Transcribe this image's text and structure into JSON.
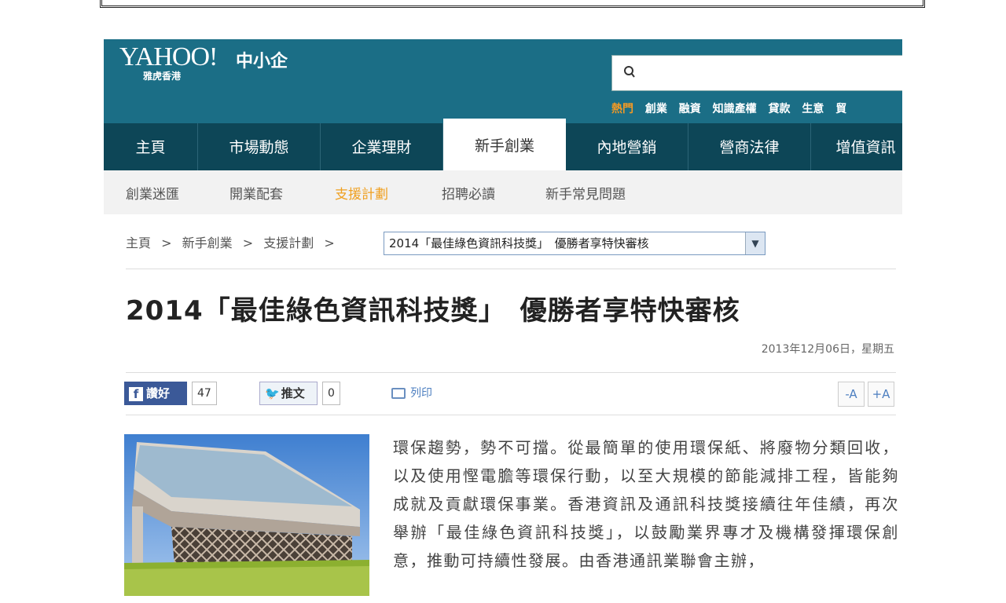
{
  "header": {
    "logo_text": "YAHOO!",
    "logo_sub": "雅虎香港",
    "section_name": "中小企",
    "search_placeholder": "",
    "topics": [
      "熱門",
      "創業",
      "融資",
      "知識產權",
      "貸款",
      "生意",
      "貿"
    ]
  },
  "nav": {
    "items": [
      {
        "label": "主頁"
      },
      {
        "label": "市場動態"
      },
      {
        "label": "企業理財"
      },
      {
        "label": "新手創業"
      },
      {
        "label": "內地營銷"
      },
      {
        "label": "營商法律"
      },
      {
        "label": "增值資訊"
      }
    ],
    "active_index": 3
  },
  "subnav": {
    "items": [
      "創業迷匯",
      "開業配套",
      "支援計劃",
      "招聘必讀",
      "新手常見問題"
    ],
    "active_index": 2
  },
  "breadcrumb": {
    "items": [
      "主頁",
      "新手創業",
      "支援計劃"
    ],
    "separator": ">",
    "selected": "2014「最佳綠色資訊科技獎」　優勝者享特快審核"
  },
  "article": {
    "title": "2014「最佳綠色資訊科技獎」　優勝者享特快審核",
    "date": "2013年12月06日，星期五",
    "body": "環保趨勢，勢不可擋。從最簡單的使用環保紙、將廢物分類回收，以及使用慳電膽等環保行動，以至大規模的節能減排工程，皆能夠成就及貢獻環保事業。香港資訊及通訊科技獎接續往年佳績，再次舉辦「最佳綠色資訊科技獎」，以鼓勵業界專才及機構發揮環保創意，推動可持續性發展。由香港通訊業聯會主辦，"
  },
  "social": {
    "like_label": "讚好",
    "like_count": "47",
    "tweet_label": "推文",
    "tweet_count": "0",
    "print_label": "列印",
    "font_smaller": "-A",
    "font_larger": "+A"
  },
  "colors": {
    "header_bg": "#1b6e86",
    "nav_bg": "#0d4657",
    "accent_orange": "#f0a020",
    "facebook_blue": "#3b5998"
  }
}
